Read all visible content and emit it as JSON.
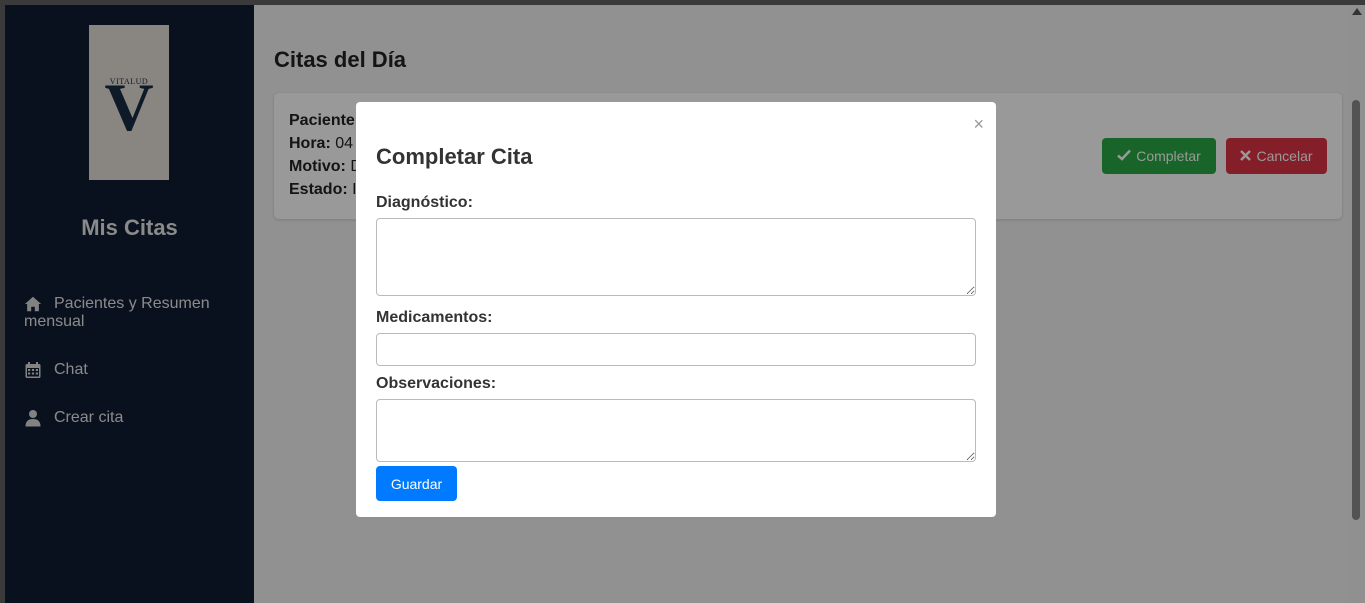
{
  "sidebar": {
    "logo_brand": "VITALUD",
    "logo_mark": "V",
    "title": "Mis Citas",
    "items": [
      {
        "label_line1": "Pacientes y Resumen",
        "label_line2": "mensual",
        "icon": "home-icon"
      },
      {
        "label": "Chat",
        "icon": "calendar-icon"
      },
      {
        "label": "Crear cita",
        "icon": "user-icon"
      }
    ]
  },
  "main": {
    "title": "Citas del Día",
    "appointment": {
      "patient_label": "Paciente",
      "patient_value": "",
      "time_label": "Hora:",
      "time_value": "04",
      "reason_label": "Motivo:",
      "reason_value": "D",
      "status_label": "Estado:",
      "status_value": "I"
    },
    "complete_button": "Completar",
    "cancel_button": "Cancelar"
  },
  "modal": {
    "close": "×",
    "title": "Completar Cita",
    "diagnosis_label": "Diagnóstico:",
    "diagnosis_value": "",
    "medications_label": "Medicamentos:",
    "medications_value": "",
    "observations_label": "Observaciones:",
    "observations_value": "",
    "save_button": "Guardar"
  },
  "colors": {
    "sidebar_bg": "#0f1d33",
    "complete": "#28a745",
    "cancel": "#dc3545",
    "primary": "#007bff"
  }
}
